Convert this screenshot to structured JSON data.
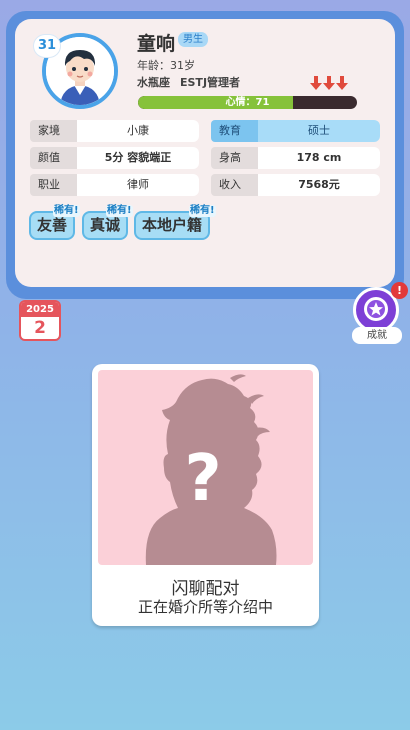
{
  "profile": {
    "age_badge": "31",
    "name": "童响",
    "gender": "男生",
    "age_line": "年龄：31岁",
    "zodiac": "水瓶座",
    "mbti": "ESTJ管理者",
    "mood_label": "心情：71",
    "mood_value": 71,
    "mood_max": 100,
    "mood_trend_icon": "triple-down-arrow-icon"
  },
  "attributes": {
    "family": {
      "label": "家境",
      "value": "小康"
    },
    "education": {
      "label": "教育",
      "value": "硕士"
    },
    "looks": {
      "label": "颜值",
      "value": "5分 容貌端正"
    },
    "height": {
      "label": "身高",
      "value": "178 cm"
    },
    "job": {
      "label": "职业",
      "value": "律师"
    },
    "income": {
      "label": "收入",
      "value": "7568元"
    }
  },
  "traits": [
    {
      "label": "友善",
      "rare": "稀有!"
    },
    {
      "label": "真诚",
      "rare": "稀有!"
    },
    {
      "label": "本地户籍",
      "rare": "稀有!"
    }
  ],
  "achievement": {
    "label": "成就",
    "alert": "!",
    "icon": "medal-star-icon"
  },
  "calendar": {
    "year": "2025",
    "month": "2"
  },
  "match": {
    "title": "闪聊配对",
    "subtitle": "正在婚介所等介绍中",
    "mystery": "?"
  },
  "colors": {
    "card_border": "#5b8fdc",
    "mood_fill": "#86c23a",
    "highlight": "#a8dcf8",
    "achievement": "#7d3fd6",
    "calendar": "#e5555c"
  }
}
